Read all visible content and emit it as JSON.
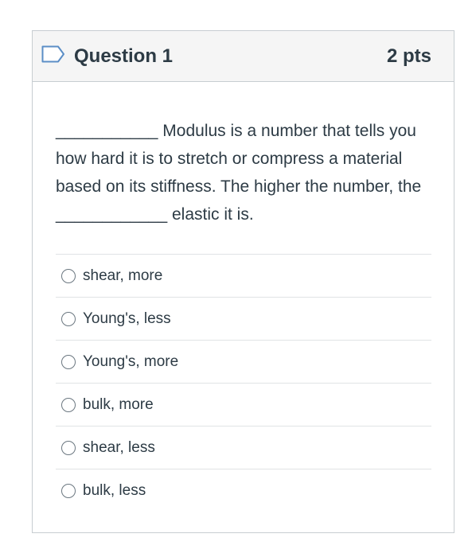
{
  "question": {
    "title": "Question 1",
    "points": "2 pts",
    "flag_icon": "flag-outline-icon",
    "text": "___________ Modulus is a number that tells you how hard it is to stretch or compress a material based on its stiffness. The higher the number, the ____________ elastic it is.",
    "answers": [
      {
        "label": "shear, more"
      },
      {
        "label": "Young's, less"
      },
      {
        "label": "Young's, more"
      },
      {
        "label": "bulk, more"
      },
      {
        "label": "shear, less"
      },
      {
        "label": "bulk, less"
      }
    ]
  },
  "colors": {
    "text": "#2d3b45",
    "header_bg": "#f5f5f5",
    "border": "#c7cdd1",
    "flag": "#5b8ec6"
  }
}
